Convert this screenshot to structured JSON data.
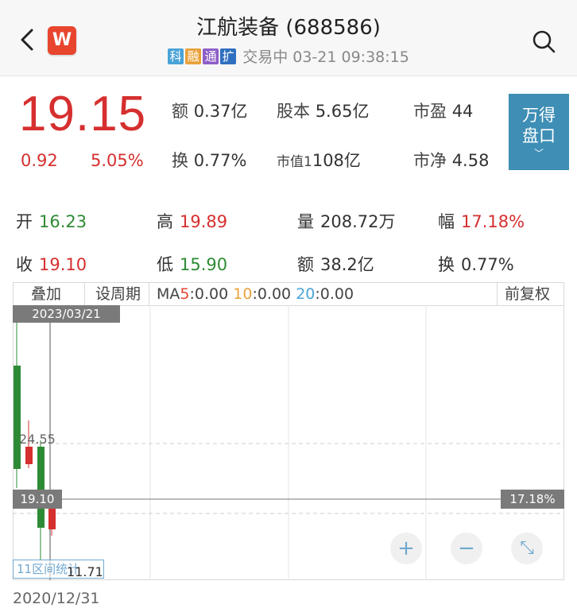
{
  "header": {
    "title": "江航装备 (688586)",
    "tags": [
      "科",
      "融",
      "通",
      "扩"
    ],
    "status": "交易中 03-21 09:38:15",
    "logo_letter": "W"
  },
  "quote": {
    "price": "19.15",
    "change": "0.92",
    "change_pct": "5.05%",
    "stats": [
      {
        "label": "额",
        "value": "0.37亿"
      },
      {
        "label": "股本",
        "value": "5.65亿"
      },
      {
        "label": "市盈",
        "value": "44"
      },
      {
        "label": "换",
        "value": "0.77%"
      },
      {
        "label": "市值1",
        "value": "108亿"
      },
      {
        "label": "市净",
        "value": "4.58"
      }
    ],
    "wande_button": {
      "line1": "万得",
      "line2": "盘口",
      "arrow": "﹀"
    }
  },
  "details": [
    {
      "label": "开",
      "value": "16.23",
      "color": "green"
    },
    {
      "label": "高",
      "value": "19.89",
      "color": "red"
    },
    {
      "label": "量",
      "value": "208.72万",
      "color": "dark"
    },
    {
      "label": "幅",
      "value": "17.18%",
      "color": "red"
    },
    {
      "label": "收",
      "value": "19.10",
      "color": "red"
    },
    {
      "label": "低",
      "value": "15.90",
      "color": "green"
    },
    {
      "label": "额",
      "value": "38.2亿",
      "color": "dark"
    },
    {
      "label": "换",
      "value": "0.77%",
      "color": "dark"
    }
  ],
  "chart_toolbar": {
    "overlay": "叠加",
    "set_period": "设周期",
    "ma_prefix": "MA",
    "ma5": "5",
    "ma5_value": ":0.00",
    "ma10": "10",
    "ma10_value": ":0.00",
    "ma20": "20",
    "ma20_value": ":0.00",
    "adjust": "前复权"
  },
  "chart": {
    "date_tag": "2023/03/21",
    "price_mid": "24.55",
    "price_line_left": "19.10",
    "price_line_right": "17.18%",
    "stat_label": "11区间统计",
    "cursor_value": "11.71",
    "bottom_date": "2020/12/31",
    "zoom_in": "+",
    "zoom_out": "−",
    "fullscreen": "⤡"
  },
  "colors": {
    "up": "#d62f2f",
    "down": "#2e8b35",
    "accent": "#3e8eb5",
    "logo": "#e8452f"
  },
  "icons": {
    "back": "chevron-left-icon",
    "search": "search-icon"
  }
}
